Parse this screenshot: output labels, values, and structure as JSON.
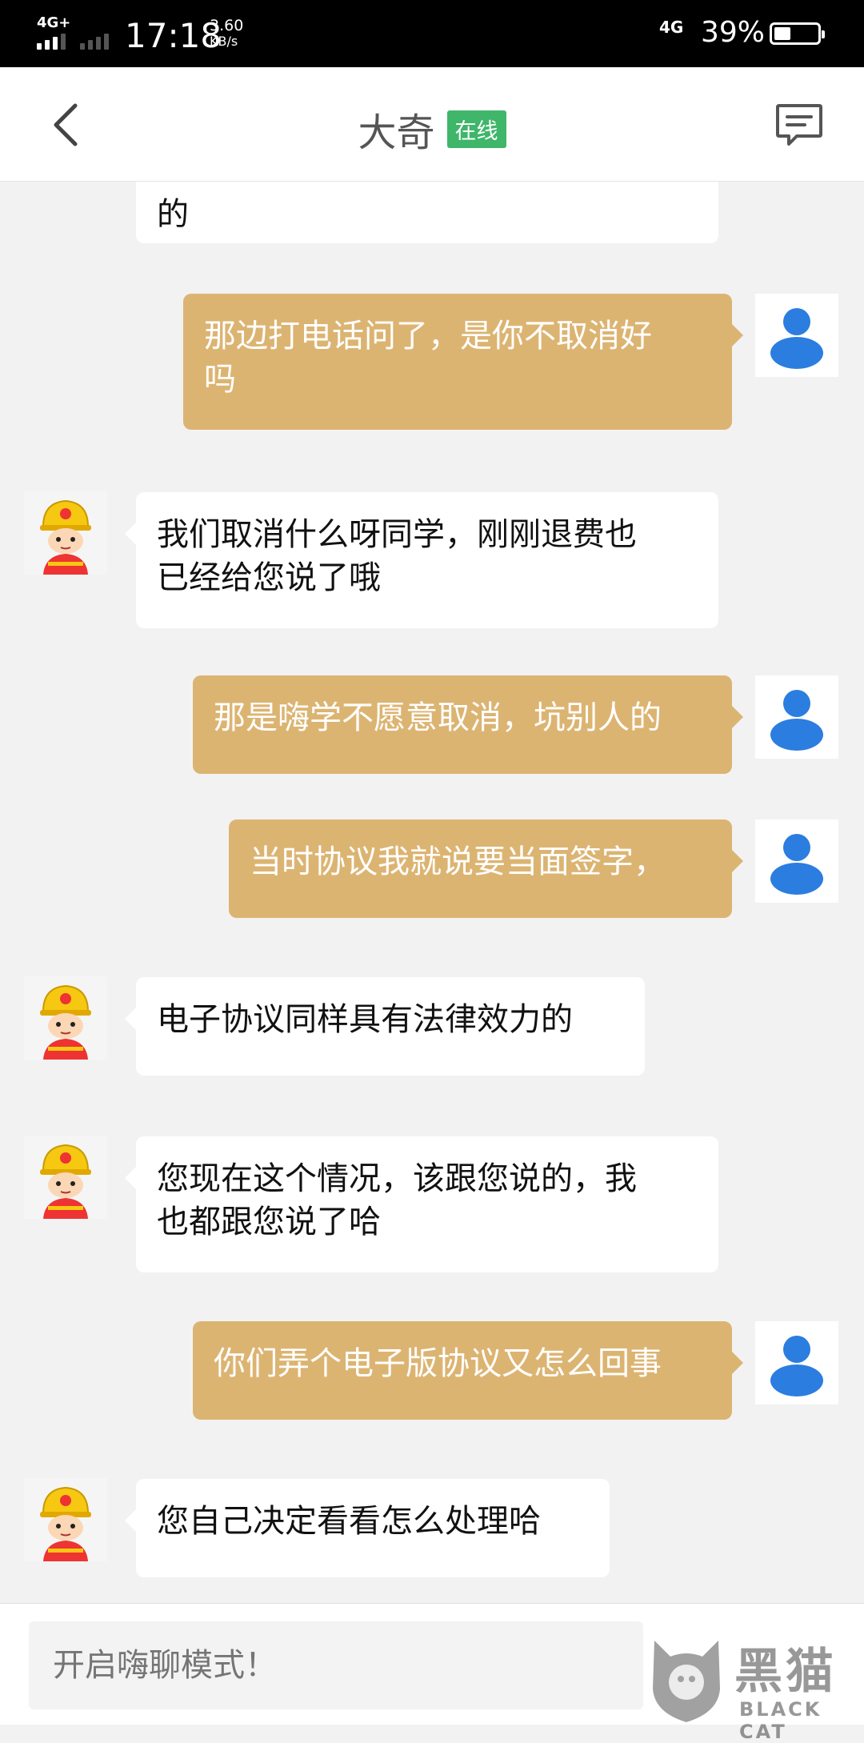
{
  "status_bar": {
    "network_left": "4G+",
    "time": "17:18",
    "speed_value": "3.60",
    "speed_unit": "KB/s",
    "network_right": "4G",
    "battery_percent": "39%",
    "battery_level": 0.39
  },
  "header": {
    "title": "大奇",
    "status_badge": "在线"
  },
  "messages": [
    {
      "side": "in",
      "text": "的"
    },
    {
      "side": "out",
      "text": "那边打电话问了，是你不取消好\n吗"
    },
    {
      "side": "in",
      "text": "我们取消什么呀同学，刚刚退费也\n已经给您说了哦"
    },
    {
      "side": "out",
      "text": "那是嗨学不愿意取消，坑别人的"
    },
    {
      "side": "out",
      "text": "当时协议我就说要当面签字，"
    },
    {
      "side": "in",
      "text": "电子协议同样具有法律效力的"
    },
    {
      "side": "in",
      "text": "您现在这个情况，该跟您说的，我\n也都跟您说了哈"
    },
    {
      "side": "out",
      "text": "你们弄个电子版协议又怎么回事"
    },
    {
      "side": "in",
      "text": "您自己决定看看怎么处理哈"
    }
  ],
  "input": {
    "placeholder": "开启嗨聊模式！"
  },
  "watermark": {
    "text": "黑猫",
    "subtext": "BLACK CAT"
  },
  "colors": {
    "outgoing_bubble": "#dcb472",
    "incoming_bubble": "#ffffff",
    "online_badge": "#3fb66a",
    "user_avatar": "#2b7de0"
  }
}
